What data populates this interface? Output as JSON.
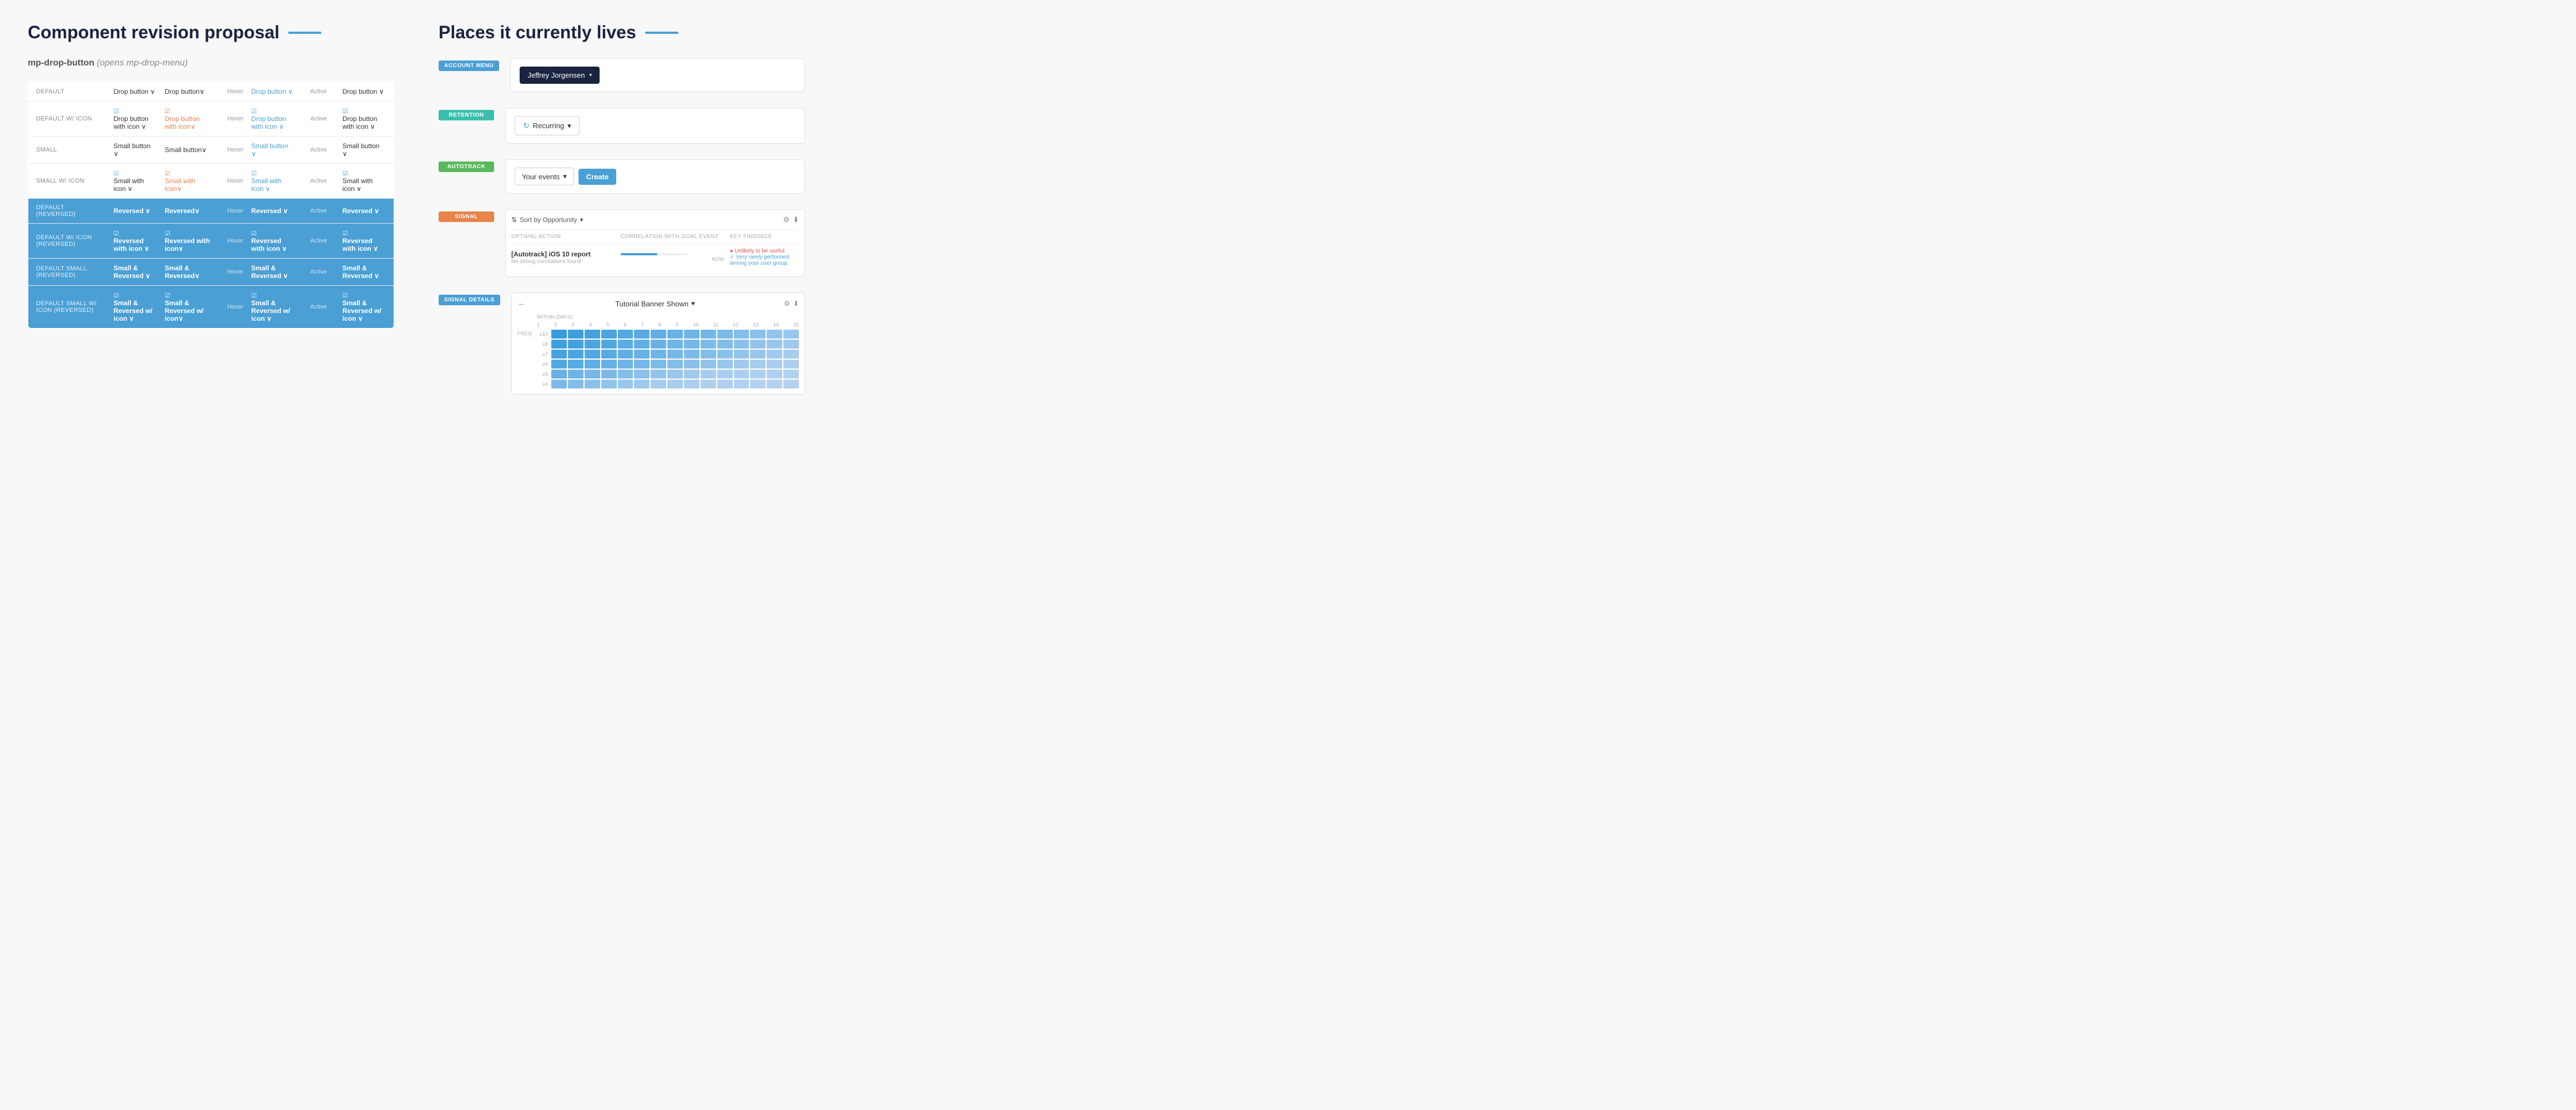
{
  "left": {
    "title": "Component revision proposal",
    "subtitle_prefix": "mp-drop-button",
    "subtitle_italic": "(opens mp-drop-menu)",
    "table": {
      "columns": [
        "",
        "Drop button ∨",
        "Hover",
        "Active"
      ],
      "rows": [
        {
          "label": "DEFAULT",
          "default": "Drop button ∨",
          "state_label": "Drop button∨",
          "hover_label": "Drop button ∨",
          "hover_prefix": "Hover",
          "active_label": "Drop button ∨",
          "active_prefix": "Active",
          "reversed": false,
          "has_icon": false
        },
        {
          "label": "DEFAULT w/ ICON",
          "default": "Drop button with icon ∨",
          "state_label": "Drop button with icon∨",
          "hover_label": "Drop button with icon ∨",
          "hover_prefix": "Hover",
          "active_label": "Drop button with icon ∨",
          "active_prefix": "Active",
          "reversed": false,
          "has_icon": true
        },
        {
          "label": "SMALL",
          "default": "Small button ∨",
          "state_label": "Small button∨",
          "hover_label": "Small button ∨",
          "hover_prefix": "Hover",
          "active_label": "Small button ∨",
          "active_prefix": "Active",
          "reversed": false,
          "has_icon": false
        },
        {
          "label": "SMALL w/ ICON",
          "default": "Small with icon ∨",
          "state_label": "Small with icon∨",
          "hover_label": "Small with icon ∨",
          "hover_prefix": "Hover",
          "active_label": "Small with icon ∨",
          "active_prefix": "Active",
          "reversed": false,
          "has_icon": true
        },
        {
          "label": "DEFAULT (REVERSED)",
          "default": "Reversed ∨",
          "state_label": "Reversed∨",
          "hover_label": "Reversed ∨",
          "hover_prefix": "Hover",
          "active_label": "Reversed ∨",
          "active_prefix": "Active",
          "reversed": true,
          "has_icon": false
        },
        {
          "label": "DEFAULT w/ ICON (REVERSED)",
          "default": "Reversed with icon ∨",
          "state_label": "Reversed with icon∨",
          "hover_label": "Reversed with icon ∨",
          "hover_prefix": "Hover",
          "active_label": "Reversed with icon ∨",
          "active_prefix": "Active",
          "reversed": true,
          "has_icon": true
        },
        {
          "label": "DEFAULT SMALL (REVERSED)",
          "default": "Small & Reversed ∨",
          "state_label": "Small & Reversed∨",
          "hover_label": "Small & Reversed ∨",
          "hover_prefix": "Hover",
          "active_label": "Small & Reversed ∨",
          "active_prefix": "Active",
          "reversed": true,
          "has_icon": false
        },
        {
          "label": "DEFAULT SMALL w/ ICON (REVERSED)",
          "default": "Small & Reversed w/ icon ∨",
          "state_label": "Small & Reversed w/ icon∨",
          "hover_label": "Small & Reversed w/ icon ∨",
          "hover_prefix": "Hover",
          "active_label": "Small & Reversed w/ icon ∨",
          "active_prefix": "Active",
          "reversed": true,
          "has_icon": true
        }
      ]
    }
  },
  "right": {
    "title": "Places it currently lives",
    "places": [
      {
        "tag": "ACCOUNT MENU",
        "tag_color": "tag-blue",
        "type": "account-menu",
        "preview_user": "Jeffrey Jorgensen"
      },
      {
        "tag": "RETENTION",
        "tag_color": "tag-teal",
        "type": "retention",
        "preview_text": "Recurring"
      },
      {
        "tag": "AUTOTRACK",
        "tag_color": "tag-green",
        "type": "autotrack",
        "preview_events": "Your events",
        "preview_create": "Create"
      },
      {
        "tag": "SIGNAL",
        "tag_color": "tag-orange",
        "type": "signal",
        "sort_label": "Sort by Opportunity",
        "col1": "Optimal action",
        "col2": "Correlation with goal event",
        "col3": "Key findings",
        "row_title": "[Autotrack] iOS 10 report",
        "row_sub": "No strong correlations found",
        "finding1": "● Unlikely to be useful.",
        "finding2": "✓ Very rarely performed among your user group.",
        "now": "NOW"
      },
      {
        "tag": "SIGNAL DETAILS",
        "tag_color": "tag-blue",
        "type": "signal-details",
        "back_arrow": "←",
        "heatmap_title": "Tutorial Banner Shown",
        "freq_label": "FREQ.",
        "within_label": "WITHIN (DAYS)",
        "y_labels": [
          "≥10",
          "≥8",
          "≥7",
          "≥6",
          "≥5",
          "≥4"
        ],
        "x_labels": [
          "1",
          "2",
          "3",
          "4",
          "5",
          "6",
          "7",
          "8",
          "9",
          "10",
          "11",
          "12",
          "13",
          "14",
          "15"
        ]
      }
    ]
  },
  "colors": {
    "blue": "#4a9fd4",
    "dark_navy": "#1a2340",
    "teal": "#3bbfad",
    "green": "#5ab85c",
    "orange": "#e8834a",
    "heatmap_light": "#b8d9f0",
    "heatmap_mid": "#6ab0e0",
    "heatmap_dark": "#2d8ec8"
  }
}
